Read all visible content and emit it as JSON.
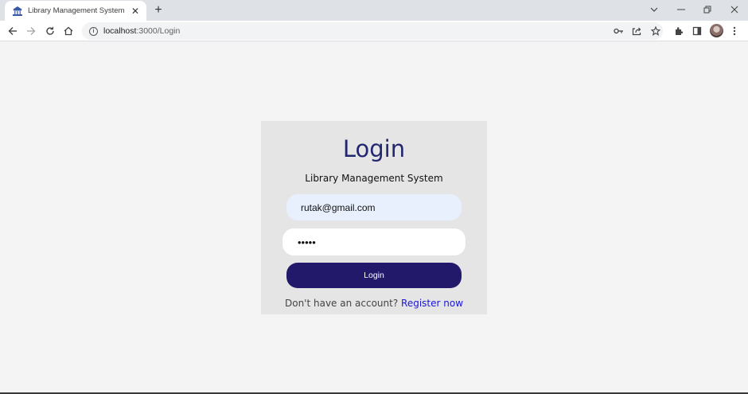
{
  "browser": {
    "tab_title": "Library Management System",
    "url_host": "localhost",
    "url_path": ":3000/Login"
  },
  "login": {
    "title": "Login",
    "subtitle": "Library Management System",
    "email_value": "rutak@gmail.com",
    "password_value": "•••••",
    "button_label": "Login",
    "register_prompt": "Don't have an account?",
    "register_link": "Register now"
  },
  "colors": {
    "accent": "#22196a",
    "title": "#232770",
    "link": "#1a16d9",
    "card_bg": "#e5e5e5",
    "page_bg": "#f4f4f4",
    "email_bg": "#e8f0fe"
  },
  "icons": [
    "library-favicon",
    "close-icon",
    "plus-icon",
    "chevron-down-icon",
    "minimize-icon",
    "restore-icon",
    "window-close-icon",
    "back-arrow-icon",
    "forward-arrow-icon",
    "reload-icon",
    "home-icon",
    "info-icon",
    "key-icon",
    "share-icon",
    "star-icon",
    "puzzle-icon",
    "side-panel-icon",
    "kebab-menu-icon"
  ]
}
